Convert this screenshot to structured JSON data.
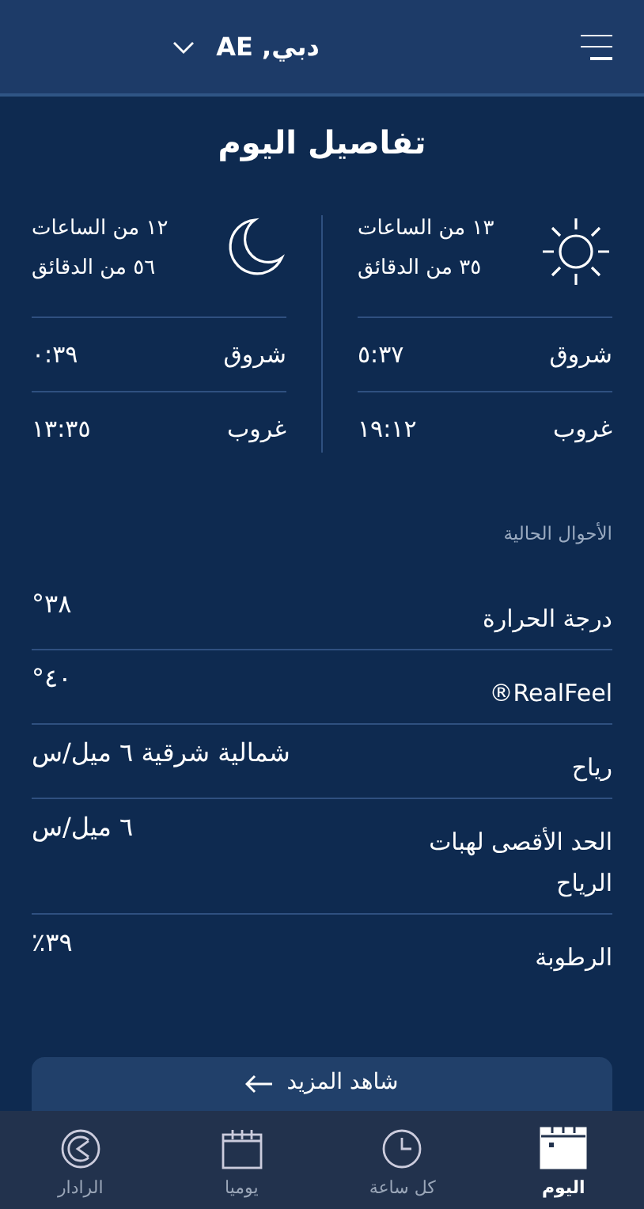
{
  "header": {
    "location": "دبي, AE"
  },
  "title": "تفاصيل اليوم",
  "celestial": [
    {
      "kind": "sun",
      "duration": [
        "١٣ من الساعات",
        "٣٥ من الدقائق"
      ],
      "rise_label": "شروق",
      "rise": "٥:٣٧",
      "set_label": "غروب",
      "set": "١٩:١٢"
    },
    {
      "kind": "moon",
      "duration": [
        "١٢ من الساعات",
        "٥٦ من الدقائق"
      ],
      "rise_label": "شروق",
      "rise": "٠:٣٩",
      "set_label": "غروب",
      "set": "١٣:٣٥"
    }
  ],
  "conditions": {
    "heading": "الأحوال الحالية",
    "rows": [
      {
        "label": "درجة الحرارة",
        "value": "٣٨°"
      },
      {
        "label": "RealFeel®",
        "value": "٤٠°"
      },
      {
        "label": "رياح",
        "value": "شمالية شرقية ٦ ميل/س"
      },
      {
        "label": "الحد الأقصى لهبات الرياح",
        "value": "٦ ميل/س"
      },
      {
        "label": "الرطوبة",
        "value": "٣٩٪"
      }
    ]
  },
  "more_button": "شاهد المزيد",
  "nav": [
    {
      "kind": "today",
      "label": "اليوم",
      "selected": true
    },
    {
      "kind": "hourly",
      "label": "كل ساعة",
      "selected": false
    },
    {
      "kind": "daily",
      "label": "يوميا",
      "selected": false
    },
    {
      "kind": "radar",
      "label": "الرادار",
      "selected": false
    }
  ]
}
